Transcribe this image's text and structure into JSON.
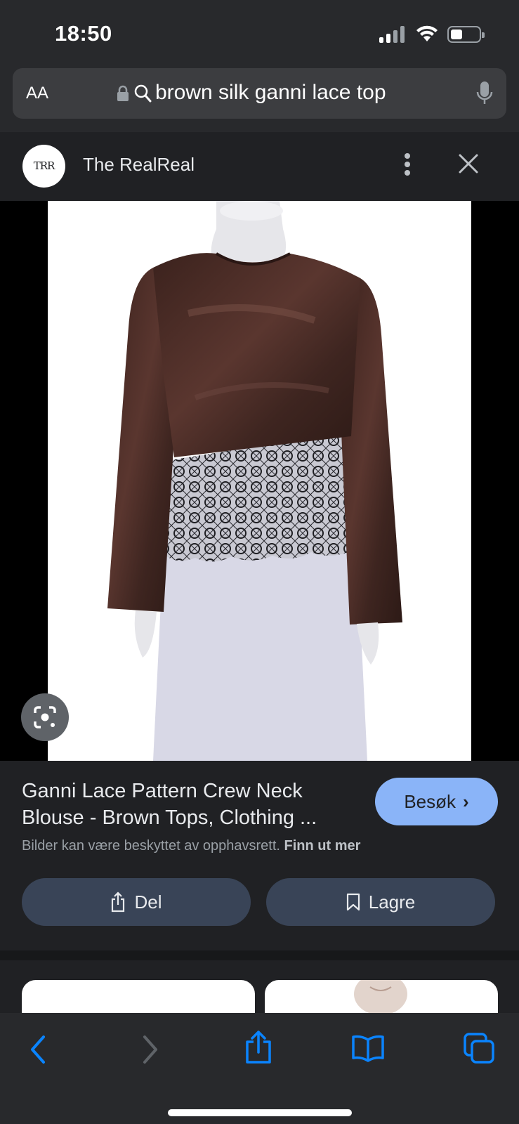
{
  "status_bar": {
    "time": "18:50"
  },
  "address_bar": {
    "text_size_label": "AA",
    "query": "brown silk ganni lace top"
  },
  "source": {
    "logo_text": "TRR",
    "name": "The RealReal"
  },
  "result": {
    "title_line1": "Ganni Lace Pattern Crew Neck",
    "title_line2": "Blouse - Brown Tops, Clothing ...",
    "visit_label": "Besøk",
    "copyright_text": "Bilder kan være beskyttet av opphavsrett.",
    "learn_more_label": "Finn ut mer"
  },
  "actions": {
    "share_label": "Del",
    "save_label": "Lagre"
  },
  "icons": {
    "lock": "lock-icon",
    "search": "search-icon",
    "mic": "mic-icon",
    "more": "more-vert-icon",
    "close": "close-icon",
    "lens": "lens-icon",
    "back": "back-icon",
    "forward": "forward-icon",
    "share": "share-icon",
    "bookmarks": "bookmarks-icon",
    "tabs": "tabs-icon"
  },
  "colors": {
    "accent": "#8ab4f8",
    "toolbar_blue": "#0a84ff",
    "background": "#202124",
    "button": "#394457"
  }
}
